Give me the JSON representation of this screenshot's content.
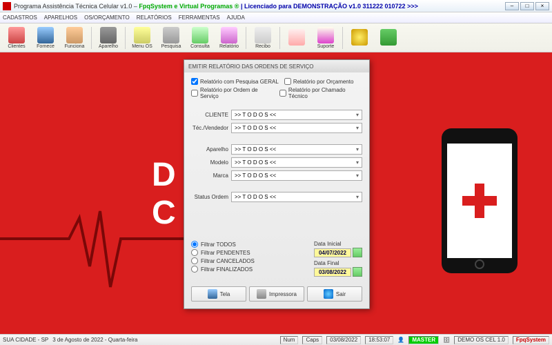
{
  "window": {
    "title_prefix": "Programa Assistência Técnica Celular v1.0 – ",
    "company": "FpqSystem e Virtual Programas ®",
    "license": " | Licenciado para  DEMONSTRAÇÃO v1.0 311222 010722 >>>"
  },
  "menu": [
    "CADASTROS",
    "APARELHOS",
    "OS/ORÇAMENTO",
    "RELATÓRIOS",
    "FERRAMENTAS",
    "AJUDA"
  ],
  "toolbar": {
    "clientes": "Clientes",
    "fornece": "Fornece",
    "funciona": "Funciona",
    "aparelho": "Aparelho",
    "menuos": "Menu OS",
    "pesquisa": "Pesquisa",
    "consulta": "Consulta",
    "relatorio": "Relatório",
    "recibo": "Recibo",
    "suporte": "Suporte"
  },
  "dialog": {
    "title": "EMITIR RELATÓRIO DAS ORDENS DE SERVIÇO",
    "chk_geral": "Relatório com Pesquisa GERAL",
    "chk_orc": "Relatório por Orçamento",
    "chk_ordem": "Relatório por Ordem de Serviço",
    "chk_chamado": "Relatório por Chamado Técnico",
    "lbl_cliente": "CLIENTE",
    "lbl_tec": "Téc./Vendedor",
    "lbl_aparelho": "Aparelho",
    "lbl_modelo": "Modelo",
    "lbl_marca": "Marca",
    "lbl_status": "Status Ordem",
    "val_todos": ">> T O D O S <<",
    "rad_todos": "Filtrar TODOS",
    "rad_pend": "Filtrar PENDENTES",
    "rad_canc": "Filtrar CANCELADOS",
    "rad_fin": "Filtrar FINALIZADOS",
    "lbl_data_ini": "Data Inicial",
    "val_data_ini": "04/07/2022",
    "lbl_data_fin": "Data Final",
    "val_data_fin": "03/08/2022",
    "btn_tela": "Tela",
    "btn_imp": "Impressora",
    "btn_sair": "Sair"
  },
  "status": {
    "city": "SUA CIDADE - SP",
    "date_long": "3 de Agosto de 2022 - Quarta-feira",
    "num": "Num",
    "caps": "Caps",
    "date": "03/08/2022",
    "time": "18:53:07",
    "master": "MASTER",
    "demo": "DEMO OS CEL 1.0",
    "brand": "FpqSystem"
  }
}
